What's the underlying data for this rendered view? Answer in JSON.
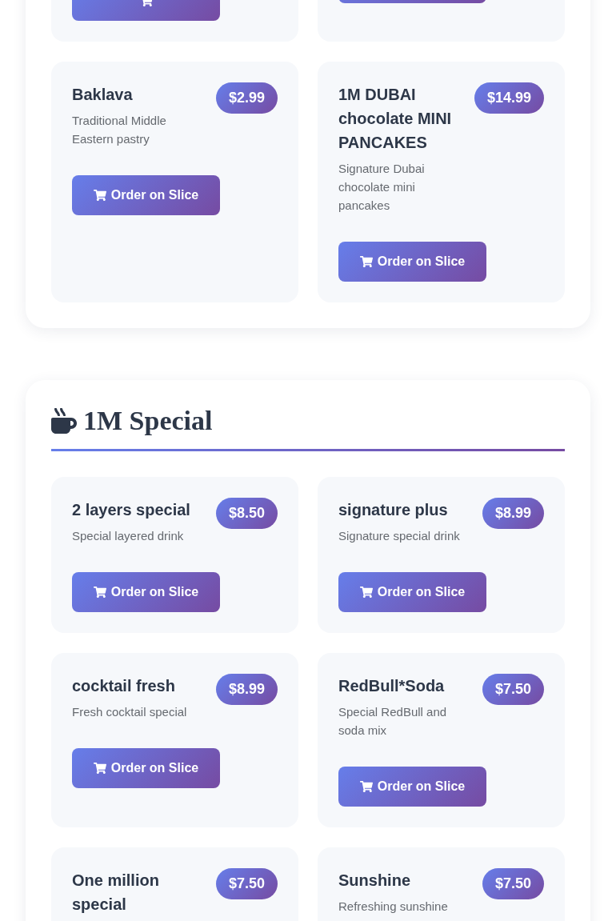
{
  "sections": [
    {
      "items": [
        {
          "kind": "cut-icon"
        },
        {
          "kind": "cut"
        },
        {
          "kind": "full",
          "name": "Baklava",
          "price": "$2.99",
          "description": "Traditional Middle Eastern pastry",
          "button": "Order on Slice"
        },
        {
          "kind": "full",
          "name": "1M DUBAI chocolate MINI PANCAKES",
          "price": "$14.99",
          "description": "Signature Dubai chocolate mini pancakes",
          "button": "Order on Slice"
        }
      ]
    },
    {
      "title": "1M Special",
      "items": [
        {
          "kind": "full",
          "name": "2 layers special",
          "price": "$8.50",
          "description": "Special layered drink",
          "button": "Order on Slice"
        },
        {
          "kind": "full",
          "name": "signature plus",
          "price": "$8.99",
          "description": "Signature special drink",
          "button": "Order on Slice"
        },
        {
          "kind": "full",
          "name": "cocktail fresh",
          "price": "$8.99",
          "description": "Fresh cocktail special",
          "button": "Order on Slice"
        },
        {
          "kind": "full",
          "name": "RedBull*Soda",
          "price": "$7.50",
          "description": "Special RedBull and soda mix",
          "button": "Order on Slice"
        },
        {
          "kind": "full",
          "name": "One million special",
          "price": "$7.50"
        },
        {
          "kind": "full",
          "name": "Sunshine",
          "price": "$7.50",
          "description": "Refreshing sunshine"
        }
      ]
    }
  ]
}
